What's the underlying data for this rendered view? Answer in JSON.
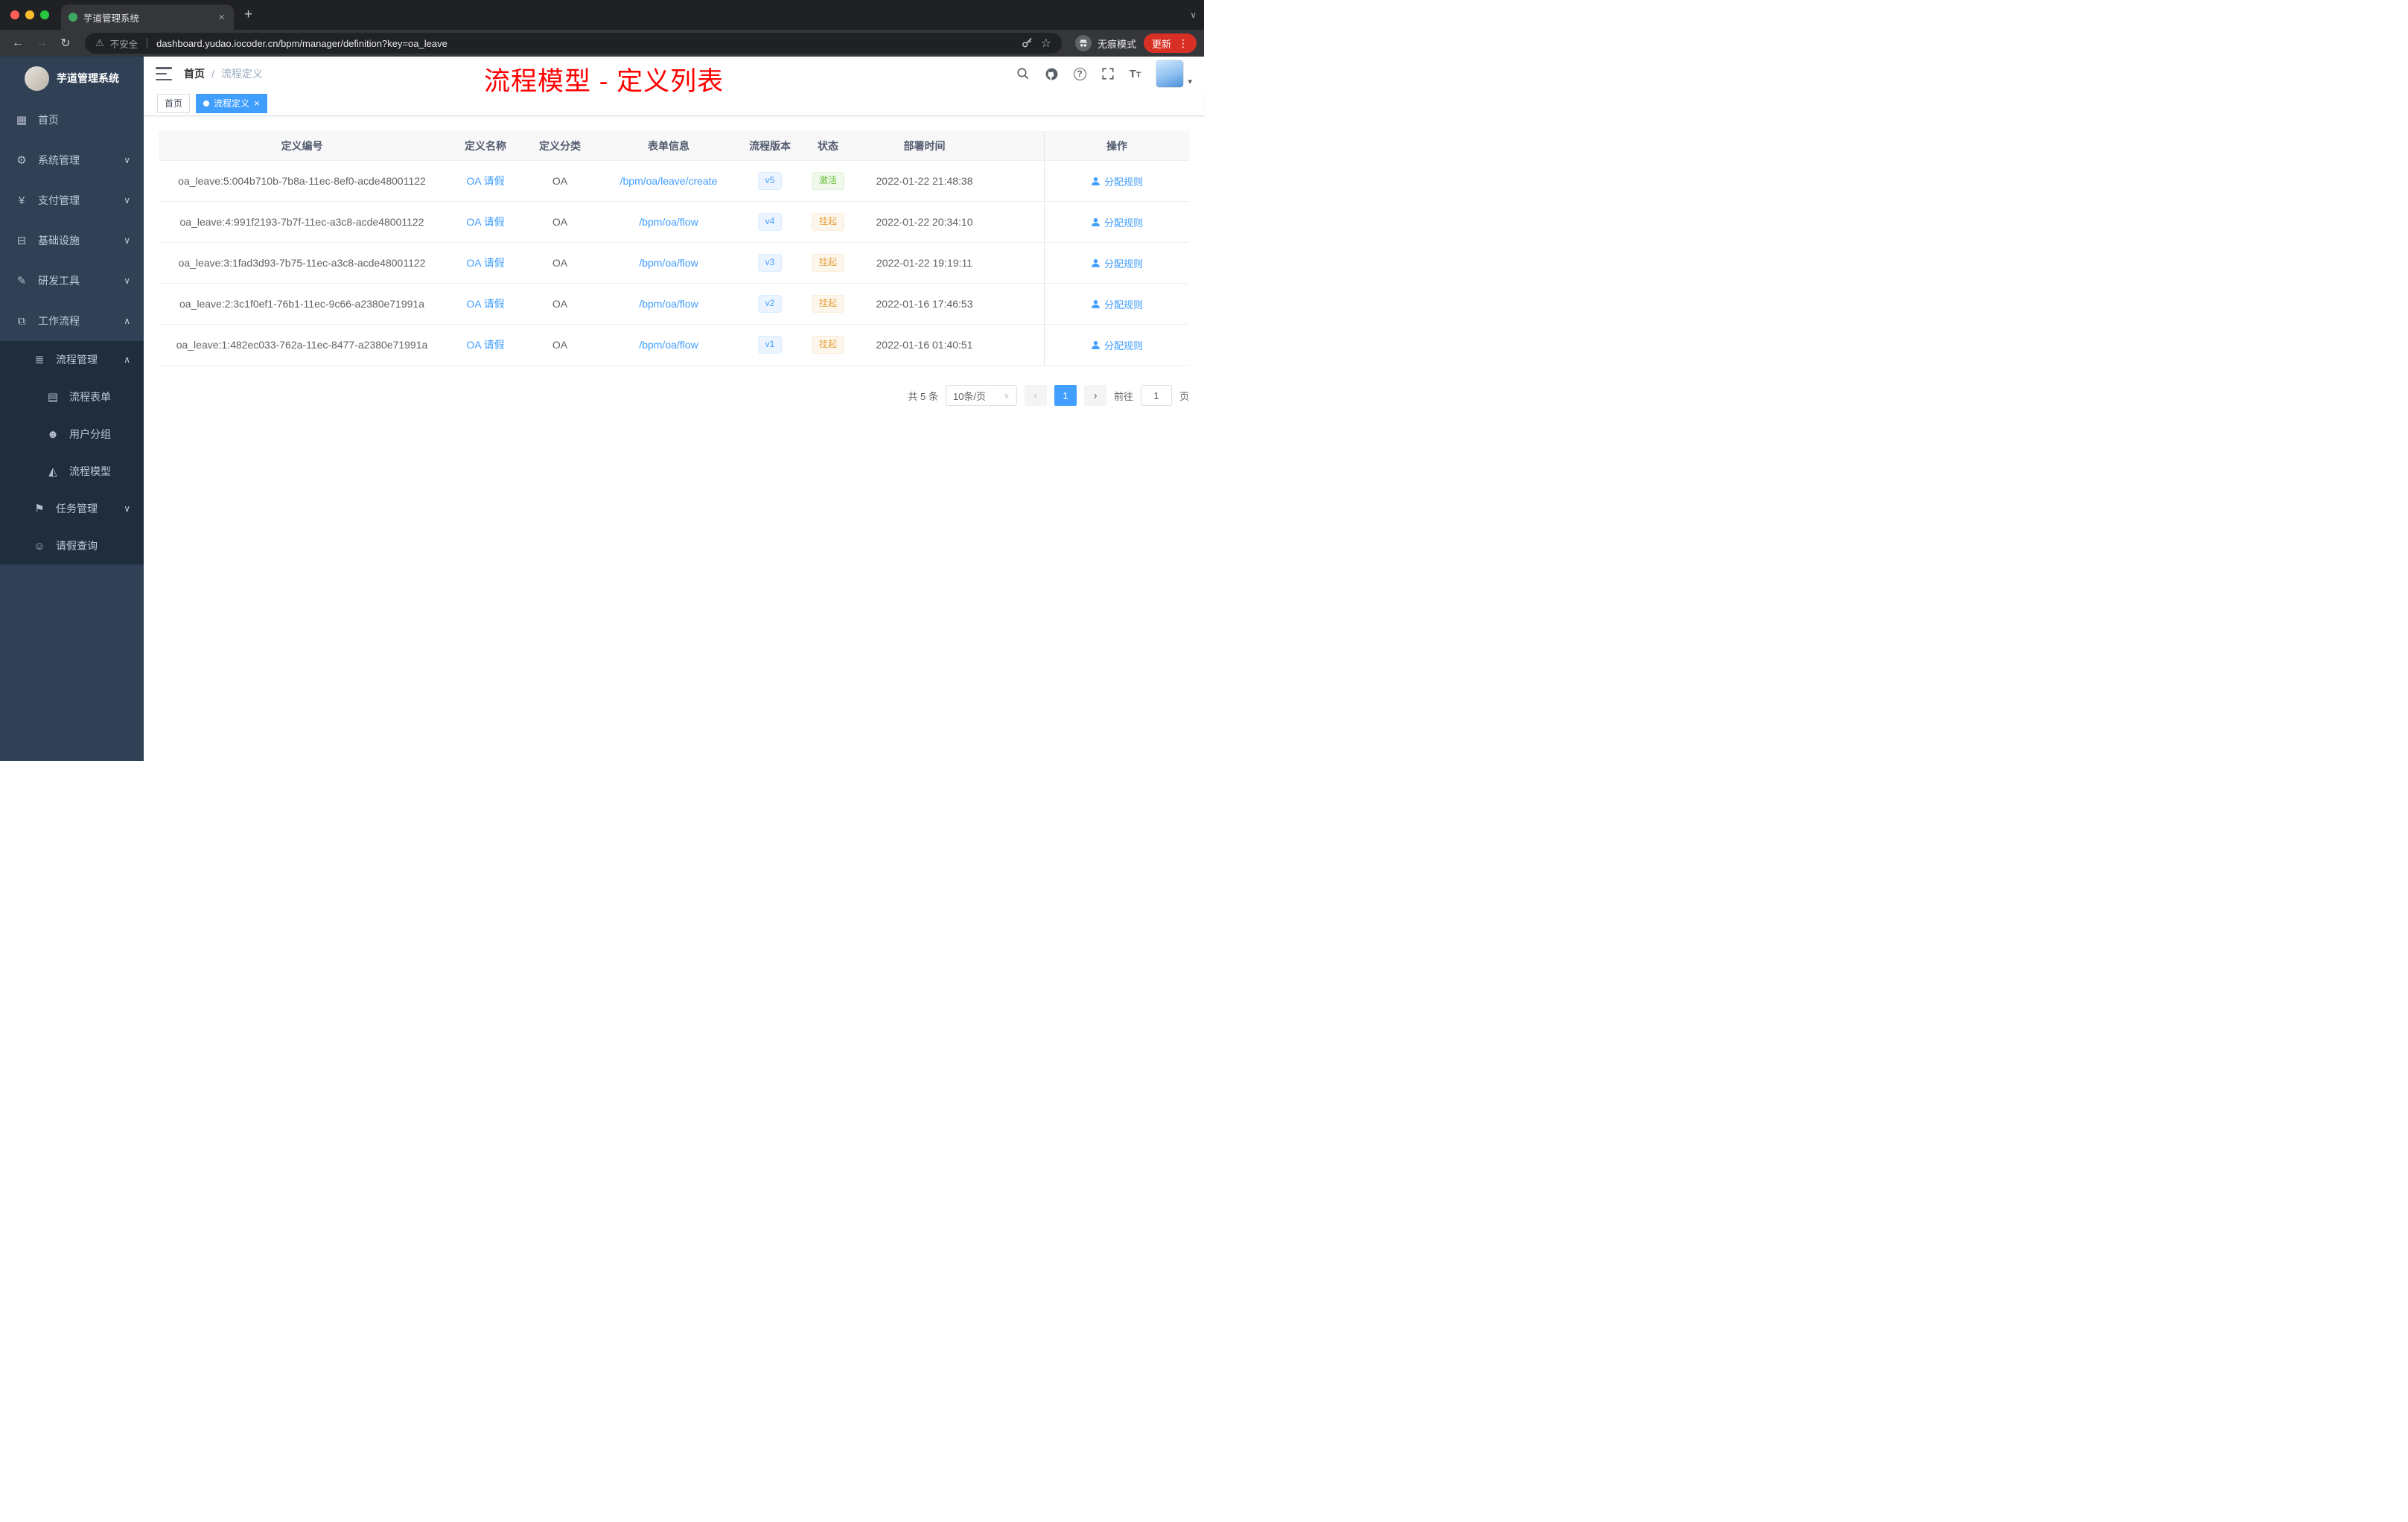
{
  "browser": {
    "tab": {
      "title": "芋道管理系统"
    },
    "address": {
      "security_label": "不安全",
      "url": "dashboard.yudao.iocoder.cn/bpm/manager/definition?key=oa_leave"
    },
    "incognito_label": "无痕模式",
    "update_button": "更新"
  },
  "sidebar": {
    "logo_title": "芋道管理系统",
    "items": [
      {
        "label": "首页"
      },
      {
        "label": "系统管理"
      },
      {
        "label": "支付管理"
      },
      {
        "label": "基础设施"
      },
      {
        "label": "研发工具"
      },
      {
        "label": "工作流程"
      },
      {
        "label": "流程管理"
      },
      {
        "label": "流程表单"
      },
      {
        "label": "用户分组"
      },
      {
        "label": "流程模型"
      },
      {
        "label": "任务管理"
      },
      {
        "label": "请假查询"
      }
    ]
  },
  "navbar": {
    "breadcrumb": {
      "home": "首页",
      "separator": "/",
      "current": "流程定义"
    }
  },
  "annotation": "流程模型 - 定义列表",
  "tags": {
    "home": "首页",
    "active": "流程定义"
  },
  "table": {
    "headers": [
      "定义编号",
      "定义名称",
      "定义分类",
      "表单信息",
      "流程版本",
      "状态",
      "部署时间",
      "操作"
    ],
    "rows": [
      {
        "id": "oa_leave:5:004b710b-7b8a-11ec-8ef0-acde48001122",
        "name": "OA 请假",
        "category": "OA",
        "form": "/bpm/oa/leave/create",
        "version": "v5",
        "status": "激活",
        "deployed": "2022-01-22 21:48:38",
        "action": "分配规则"
      },
      {
        "id": "oa_leave:4:991f2193-7b7f-11ec-a3c8-acde48001122",
        "name": "OA 请假",
        "category": "OA",
        "form": "/bpm/oa/flow",
        "version": "v4",
        "status": "挂起",
        "deployed": "2022-01-22 20:34:10",
        "action": "分配规则"
      },
      {
        "id": "oa_leave:3:1fad3d93-7b75-11ec-a3c8-acde48001122",
        "name": "OA 请假",
        "category": "OA",
        "form": "/bpm/oa/flow",
        "version": "v3",
        "status": "挂起",
        "deployed": "2022-01-22 19:19:11",
        "action": "分配规则"
      },
      {
        "id": "oa_leave:2:3c1f0ef1-76b1-11ec-9c66-a2380e71991a",
        "name": "OA 请假",
        "category": "OA",
        "form": "/bpm/oa/flow",
        "version": "v2",
        "status": "挂起",
        "deployed": "2022-01-16 17:46:53",
        "action": "分配规则"
      },
      {
        "id": "oa_leave:1:482ec033-762a-11ec-8477-a2380e71991a",
        "name": "OA 请假",
        "category": "OA",
        "form": "/bpm/oa/flow",
        "version": "v1",
        "status": "挂起",
        "deployed": "2022-01-16 01:40:51",
        "action": "分配规则"
      }
    ]
  },
  "pagination": {
    "total": "共 5 条",
    "page_size": "10条/页",
    "current_page": "1",
    "goto_label": "前往",
    "goto_value": "1",
    "page_unit": "页"
  },
  "icons": {
    "dashboard": "▦",
    "gear": "⚙",
    "yen": "¥",
    "infrastructure": "⊟",
    "devtools": "✎",
    "workflow": "⧉",
    "process": "≣",
    "form": "▤",
    "users": "☻",
    "model": "◭",
    "task": "⚑",
    "person": "☺",
    "chevron_down": "∨",
    "chevron_up": "∧",
    "close": "×",
    "plus": "+",
    "back": "←",
    "forward": "→",
    "reload": "↻",
    "warning": "⚠",
    "star": "☆",
    "kebab": "⋮",
    "caret_down": "▾",
    "question": "?",
    "prev_arrow": "‹",
    "next_arrow": "›"
  },
  "colors": {
    "primary": "#409eff",
    "success": "#67c23a",
    "warning": "#e6a23c",
    "sidebar_bg": "#304156",
    "sidebar_sub_bg": "#1f2d3d",
    "annotation_red": "#ff0000",
    "update_pill": "#d93025"
  }
}
